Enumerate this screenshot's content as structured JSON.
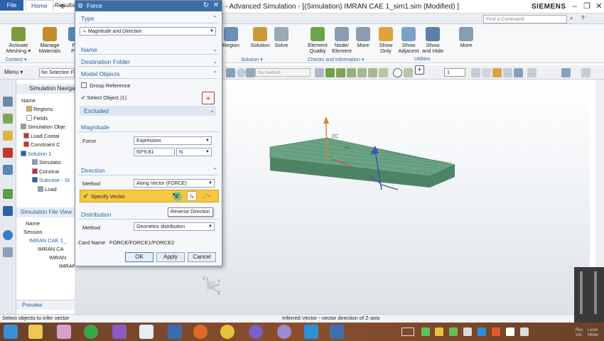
{
  "app": {
    "logo": "NX",
    "title": "- Advanced Simulation - [(Simulation) IMRAN CAE 1_sim1.sim (Modified) ]",
    "brand": "SIEMENS"
  },
  "ribbon": {
    "tabs": [
      "File",
      "Home",
      "Results"
    ],
    "left_buttons": [
      {
        "label": "Activate\nMeshing ▾",
        "icon": "mesh-icon",
        "color": "#7a9c3c"
      },
      {
        "label": "Manage\nMaterials",
        "icon": "materials-icon",
        "color": "#c58a2b"
      },
      {
        "label": "Ph\nPro",
        "icon": "physical-props-icon",
        "color": "#5a86b8"
      }
    ],
    "context_label": "Context ▾",
    "right_buttons": [
      {
        "label": "Region",
        "icon": "region-icon",
        "color": "#6c8fb8"
      },
      {
        "label": "Solution",
        "icon": "solution-icon",
        "color": "#c89a3a"
      },
      {
        "label": "Solve",
        "icon": "solve-icon",
        "color": "#9aa8b8"
      },
      {
        "label": "Element\nQuality",
        "icon": "element-quality-icon",
        "color": "#6fa34b"
      },
      {
        "label": "Node/\nElement",
        "icon": "node-element-icon",
        "color": "#8a9cb0"
      },
      {
        "label": "More",
        "icon": "more-icon",
        "color": "#8a9cb0"
      },
      {
        "label": "Show\nOnly",
        "icon": "show-only-icon",
        "color": "#e0a23a"
      },
      {
        "label": "Show\nAdjacent",
        "icon": "show-adjacent-icon",
        "color": "#7aa0c8"
      },
      {
        "label": "Show\nand Hide",
        "icon": "show-hide-icon",
        "color": "#5c7fa8"
      },
      {
        "label": "More",
        "icon": "more-icon",
        "color": "#8a9cb0"
      }
    ],
    "group_labels": [
      "Solution ▾",
      "Checks and Information ▾",
      "Utilities"
    ],
    "command_search_placeholder": "Find a Command"
  },
  "toolbar2": {
    "menu_label": "Menu ▾",
    "selection_filter": "No Selection F",
    "method_placeholder": "No method",
    "layer_value": "1"
  },
  "navigator": {
    "title": "Simulation Navigat",
    "column": "Name",
    "items": [
      {
        "label": "Regions",
        "color": "#e0b341"
      },
      {
        "label": "Fields",
        "color": "#ffffff"
      },
      {
        "label": "Simulation Obje",
        "color": "#8aa0b8"
      },
      {
        "label": "Load Contai",
        "color": "#c0392b"
      },
      {
        "label": "Constraint C",
        "color": "#c0392b"
      },
      {
        "label": "Solution 1",
        "color": "#2b63a8"
      },
      {
        "label": "Simulatio",
        "color": "#8aa0b8"
      },
      {
        "label": "Constrai",
        "color": "#c0392b"
      },
      {
        "label": "Subcase - St",
        "color": "#2b63a8"
      },
      {
        "label": "Load",
        "color": "#8aa0b8"
      }
    ],
    "file_view_title": "Simulation File View",
    "file_view_column": "Name",
    "file_items": [
      "Session",
      "IMRAN CAE 1_",
      "IMRAN CA",
      "IMRAN",
      "IMRAN ..."
    ],
    "preview": "Preview"
  },
  "dialog": {
    "title": "Force",
    "type_label": "Type",
    "type_value": "Magnitude and Direction",
    "name_label": "Name",
    "destination_label": "Destination Folder",
    "model_objects_label": "Model Objects",
    "group_reference": "Group Reference",
    "select_object": "Select Object (1)",
    "excluded": "Excluded",
    "magnitude_label": "Magnitude",
    "force_label": "Force",
    "force_type": "Expression",
    "force_value": "50*9.81",
    "force_unit": "N",
    "direction_label": "Direction",
    "method_label": "Method",
    "direction_method": "Along Vector (FORCE)",
    "specify_vector": "Specify Vector",
    "tooltip": "Reverse Direction",
    "distribution_label": "Distribution",
    "distribution_method_label": "Method",
    "distribution_method": "Geometric distribution",
    "card_name_label": "Card Name",
    "card_name_value": "FORCE/FORCE1/FORCE2",
    "ok": "OK",
    "apply": "Apply",
    "cancel": "Cancel"
  },
  "viewport": {
    "axis_labels": [
      "ZC",
      "YC"
    ],
    "triad_labels": [
      "Z",
      "Y",
      "X"
    ],
    "plate_color": "#5f9478"
  },
  "status": {
    "left": "Select objects to infer vector",
    "center": "Inferred Vector - vector direction of Z-axis"
  },
  "meter": {
    "labels": [
      "Rec\nVol.",
      "Level\nMeter"
    ]
  }
}
